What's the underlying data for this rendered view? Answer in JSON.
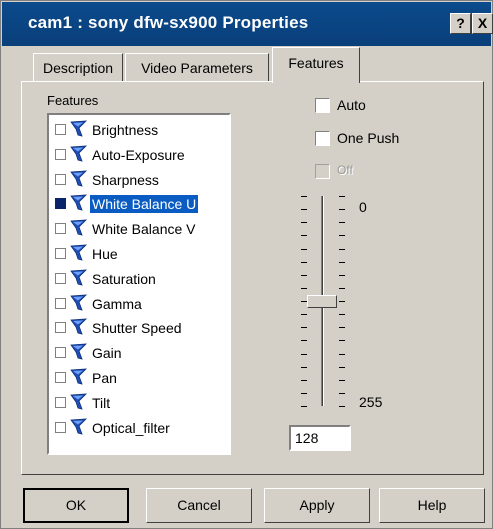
{
  "window": {
    "title": "cam1 : sony dfw-sx900 Properties",
    "help_label": "?",
    "close_label": "X"
  },
  "tabs": [
    {
      "label": "Description",
      "active": false
    },
    {
      "label": "Video Parameters",
      "active": false
    },
    {
      "label": "Features",
      "active": true
    }
  ],
  "features_panel": {
    "label": "Features",
    "items": [
      {
        "label": "Brightness",
        "checked": false,
        "selected": false,
        "icon": "feature-icon"
      },
      {
        "label": "Auto-Exposure",
        "checked": false,
        "selected": false,
        "icon": "feature-icon"
      },
      {
        "label": "Sharpness",
        "checked": false,
        "selected": false,
        "icon": "feature-icon"
      },
      {
        "label": "White Balance U",
        "checked": true,
        "selected": true,
        "icon": "feature-icon"
      },
      {
        "label": "White Balance V",
        "checked": false,
        "selected": false,
        "icon": "feature-icon"
      },
      {
        "label": "Hue",
        "checked": false,
        "selected": false,
        "icon": "feature-icon"
      },
      {
        "label": "Saturation",
        "checked": false,
        "selected": false,
        "icon": "feature-icon"
      },
      {
        "label": "Gamma",
        "checked": false,
        "selected": false,
        "icon": "feature-icon"
      },
      {
        "label": "Shutter Speed",
        "checked": false,
        "selected": false,
        "icon": "feature-icon"
      },
      {
        "label": "Gain",
        "checked": false,
        "selected": false,
        "icon": "feature-icon"
      },
      {
        "label": "Pan",
        "checked": false,
        "selected": false,
        "icon": "feature-icon"
      },
      {
        "label": "Tilt",
        "checked": false,
        "selected": false,
        "icon": "feature-icon"
      },
      {
        "label": "Optical_filter",
        "checked": false,
        "selected": false,
        "icon": "feature-icon"
      }
    ]
  },
  "options": {
    "auto": {
      "label": "Auto",
      "checked": false
    },
    "one_push": {
      "label": "One Push",
      "checked": false
    },
    "off": {
      "label": "Off",
      "checked": false,
      "disabled": true
    }
  },
  "slider": {
    "max_label": "0",
    "min_label": "255",
    "min": 0,
    "max": 255,
    "value": 128,
    "value_text": "128"
  },
  "buttons": {
    "ok": "OK",
    "cancel": "Cancel",
    "apply": "Apply",
    "help": "Help"
  },
  "colors": {
    "titlebar": "#0b4a8c",
    "selection": "#0a5cc2",
    "face": "#d4d0c8"
  }
}
